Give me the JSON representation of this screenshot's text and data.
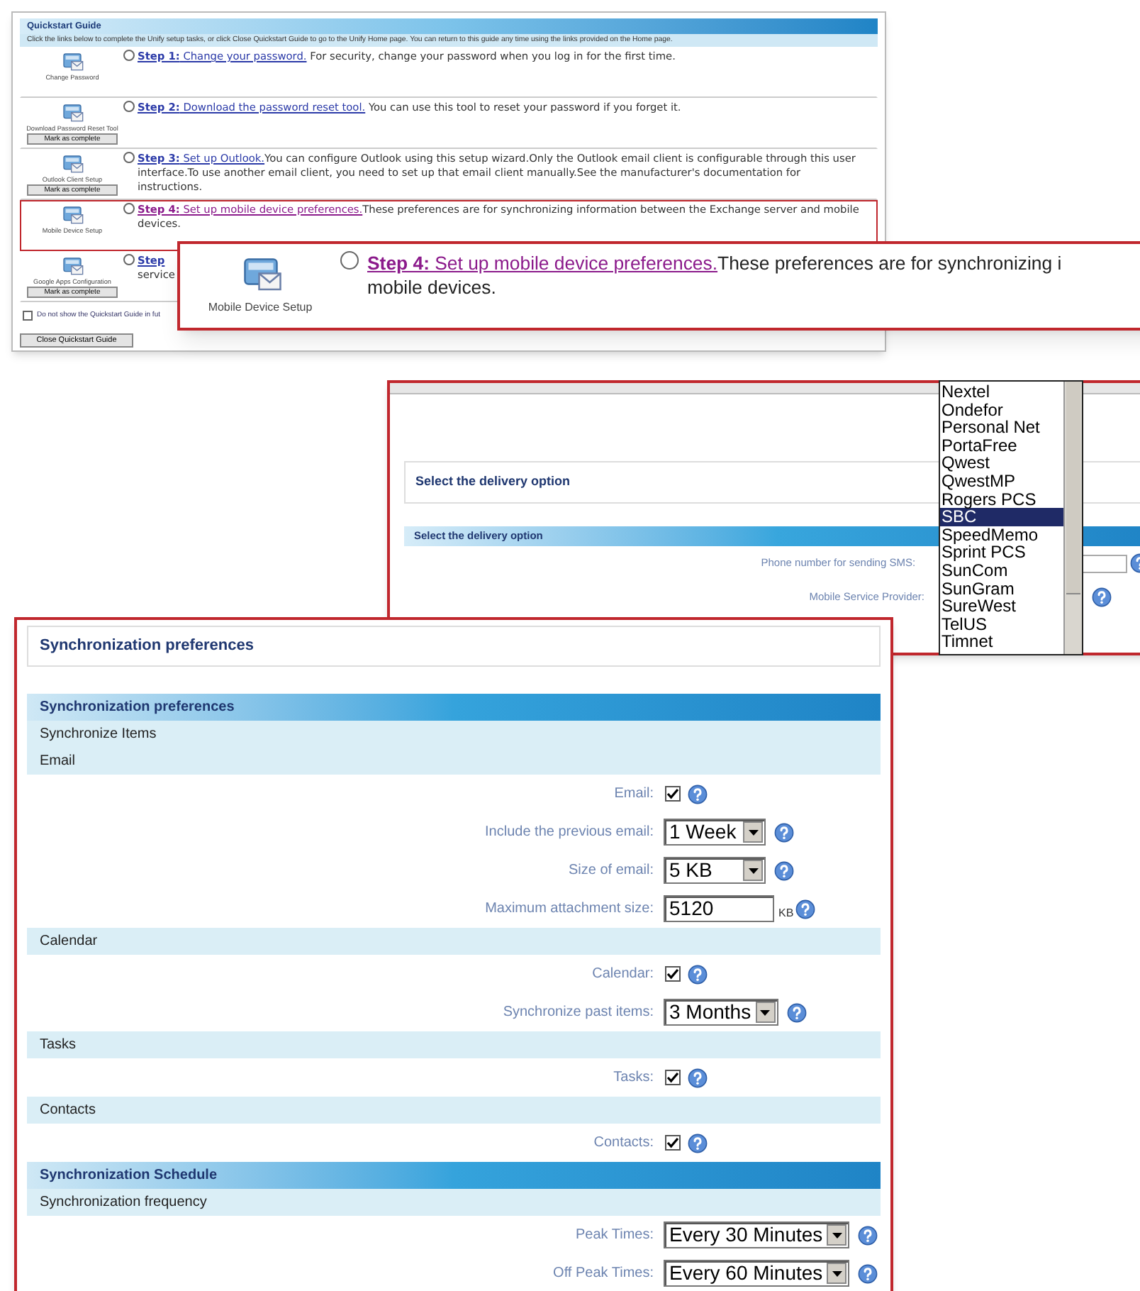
{
  "quickstart": {
    "title": "Quickstart Guide",
    "intro": "Click the links below to complete the Unify setup tasks, or click Close Quickstart Guide to go to the Unify Home page. You can return to this guide any time using the links provided on the Home page.",
    "steps": [
      {
        "icon_label": "Change Password",
        "link": "**Step 1:** Change your password.",
        "text": " For security, change your password when you log in for the first time.",
        "selected": false,
        "visited": false,
        "highlighted": false
      },
      {
        "icon_label": "Download Password Reset Tool",
        "button": "Mark as complete",
        "link": "**Step 2:** Download the password reset tool.",
        "text": " You can use this tool to reset your password if you forget it.",
        "selected": false,
        "visited": false,
        "highlighted": false
      },
      {
        "icon_label": "Outlook Client Setup",
        "button": "Mark as complete",
        "link": "**Step 3:** Set up Outlook.",
        "text": "You can configure Outlook using this setup wizard.Only the Outlook email client is configurable through this user interface.To use another email client, you need to set up that email client manually.See the manufacturer's documentation for instructions.",
        "selected": false,
        "visited": false,
        "highlighted": false
      },
      {
        "icon_label": "Mobile Device Setup",
        "link": "**Step 4:** Set up mobile device preferences.",
        "text": "These preferences are for synchronizing information between the Exchange server and mobile devices.",
        "selected": false,
        "visited": true,
        "highlighted": true
      },
      {
        "icon_label": "Google Apps Configuration",
        "button": "Mark as complete",
        "link": "**Step**",
        "text": "service",
        "selected": false,
        "visited": false,
        "highlighted": false
      }
    ],
    "dont_show": {
      "label": "Do not show the Quickstart Guide in fut",
      "checked": false
    },
    "close_button": "Close Quickstart Guide"
  },
  "callout": {
    "icon_label": "Mobile Device Setup",
    "link": "**Step 4:** Set up mobile device preferences.",
    "text": "These preferences are for synchronizing i",
    "text_line_2": "mobile devices.",
    "selected": false,
    "visited": true
  },
  "delivery": {
    "title": "Select the delivery option",
    "header": "Select the delivery option",
    "fields": [
      {
        "kind": "input",
        "label": "Phone number for sending SMS:"
      },
      {
        "kind": "select",
        "label": "Mobile Service Provider:"
      }
    ],
    "provider_list": [
      {
        "label": "Nextel",
        "selected": false
      },
      {
        "label": "Ondefor",
        "selected": false
      },
      {
        "label": "Personal Net",
        "selected": false
      },
      {
        "label": "PortaFree",
        "selected": false
      },
      {
        "label": "Qwest",
        "selected": false
      },
      {
        "label": "QwestMP",
        "selected": false
      },
      {
        "label": "Rogers PCS",
        "selected": false
      },
      {
        "label": "SBC",
        "selected": true
      },
      {
        "label": "SpeedMemo",
        "selected": false
      },
      {
        "label": "Sprint PCS",
        "selected": false
      },
      {
        "label": "SunCom",
        "selected": false
      },
      {
        "label": "SunGram",
        "selected": false
      },
      {
        "label": "SureWest",
        "selected": false
      },
      {
        "label": "TelUS",
        "selected": false
      },
      {
        "label": "Timnet",
        "selected": false
      }
    ]
  },
  "sync": {
    "title": "Synchronization preferences",
    "rows": [
      {
        "kind": "header",
        "label": "Synchronization preferences"
      },
      {
        "kind": "subheader",
        "label": "Synchronize Items"
      },
      {
        "kind": "subheader",
        "label": "Email"
      },
      {
        "kind": "checkbox",
        "label": "Email:",
        "checked": true
      },
      {
        "kind": "select",
        "label": "Include the previous email:",
        "value": "1 Week"
      },
      {
        "kind": "select",
        "label": "Size of email:",
        "value": "5 KB"
      },
      {
        "kind": "input",
        "label": "Maximum attachment size:",
        "value": "5120",
        "unit": "KB"
      },
      {
        "kind": "subheader",
        "label": "Calendar"
      },
      {
        "kind": "checkbox",
        "label": "Calendar:",
        "checked": true
      },
      {
        "kind": "select",
        "label": "Synchronize past items:",
        "value": "3 Months"
      },
      {
        "kind": "subheader",
        "label": "Tasks"
      },
      {
        "kind": "checkbox",
        "label": "Tasks:",
        "checked": true
      },
      {
        "kind": "subheader",
        "label": "Contacts"
      },
      {
        "kind": "checkbox",
        "label": "Contacts:",
        "checked": true
      },
      {
        "kind": "header",
        "label": "Synchronization Schedule"
      },
      {
        "kind": "subheader",
        "label": "Synchronization frequency"
      },
      {
        "kind": "select",
        "label": "Peak Times:",
        "value": "Every 30 Minutes"
      },
      {
        "kind": "select",
        "label": "Off Peak Times:",
        "value": "Every 60 Minutes"
      }
    ]
  }
}
